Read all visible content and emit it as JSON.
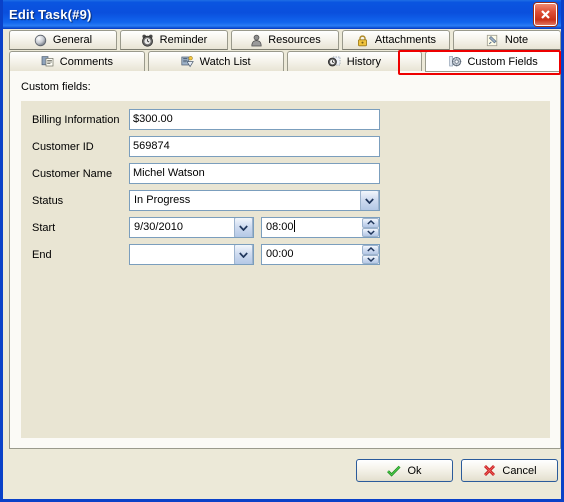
{
  "window": {
    "title": "Edit Task(#9)",
    "close_icon": "close-icon",
    "titlebar_color": "#0a55e0",
    "border_color": "#0a41c8",
    "panel_color": "#e9e5d3"
  },
  "tabs": {
    "row1": [
      {
        "label": "General",
        "icon": "sphere-icon"
      },
      {
        "label": "Reminder",
        "icon": "alarm-clock-icon"
      },
      {
        "label": "Resources",
        "icon": "person-icon"
      },
      {
        "label": "Attachments",
        "icon": "lock-icon"
      },
      {
        "label": "Note",
        "icon": "pushpin-note-icon"
      }
    ],
    "row2": [
      {
        "label": "Comments",
        "icon": "comments-icon",
        "selected": false
      },
      {
        "label": "Watch List",
        "icon": "watch-list-icon",
        "selected": false
      },
      {
        "label": "History",
        "icon": "history-clock-icon",
        "selected": false
      },
      {
        "label": "Custom Fields",
        "icon": "gear-icon",
        "selected": true
      }
    ],
    "highlight_color": "#ee0000"
  },
  "main": {
    "section_label": "Custom fields:",
    "fields": [
      {
        "label": "Billing Information",
        "type": "text",
        "value": "$300.00"
      },
      {
        "label": "Customer ID",
        "type": "text",
        "value": "569874"
      },
      {
        "label": "Customer Name",
        "type": "text",
        "value": "Michel Watson"
      },
      {
        "label": "Status",
        "type": "combo",
        "value": "In Progress"
      },
      {
        "label": "Start",
        "type": "date-time",
        "date": "9/30/2010",
        "time": "08:00"
      },
      {
        "label": "End",
        "type": "date-time",
        "date": "",
        "time": "00:00"
      }
    ]
  },
  "footer": {
    "ok_label": "Ok",
    "cancel_label": "Cancel",
    "ok_icon": "green-check-icon",
    "cancel_icon": "red-x-icon"
  }
}
